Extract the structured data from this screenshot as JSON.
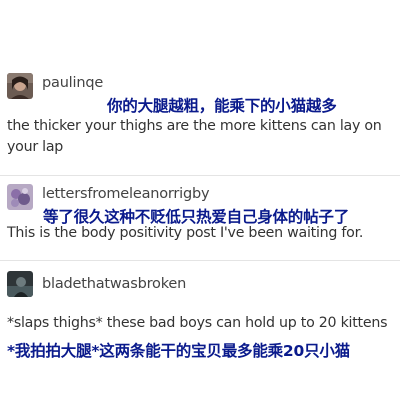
{
  "posts": [
    {
      "username": "paulinqe",
      "caption_zh": "你的大腿越粗，能乘下的小猫越多",
      "text_en": "the thicker your thighs are the more kittens can lay on your lap",
      "avatar_icon": "user-avatar-photo"
    },
    {
      "username": "lettersfromeleanorrigby",
      "caption_zh": "等了很久这种不贬低只热爱自己身体的帖子了",
      "text_en": "This is the body positivity post I've been waiting for.",
      "avatar_icon": "user-avatar-flowers"
    },
    {
      "username": "bladethatwasbroken",
      "text_en": "*slaps thighs* these bad boys can hold up to 20 kittens",
      "caption_zh": "*我拍拍大腿*这两条能干的宝贝最多能乘20只小猫",
      "avatar_icon": "user-avatar-dark"
    }
  ],
  "colors": {
    "caption": "#0a1a8c",
    "text": "#333333",
    "username": "#444444",
    "divider": "#e4e4e4"
  }
}
